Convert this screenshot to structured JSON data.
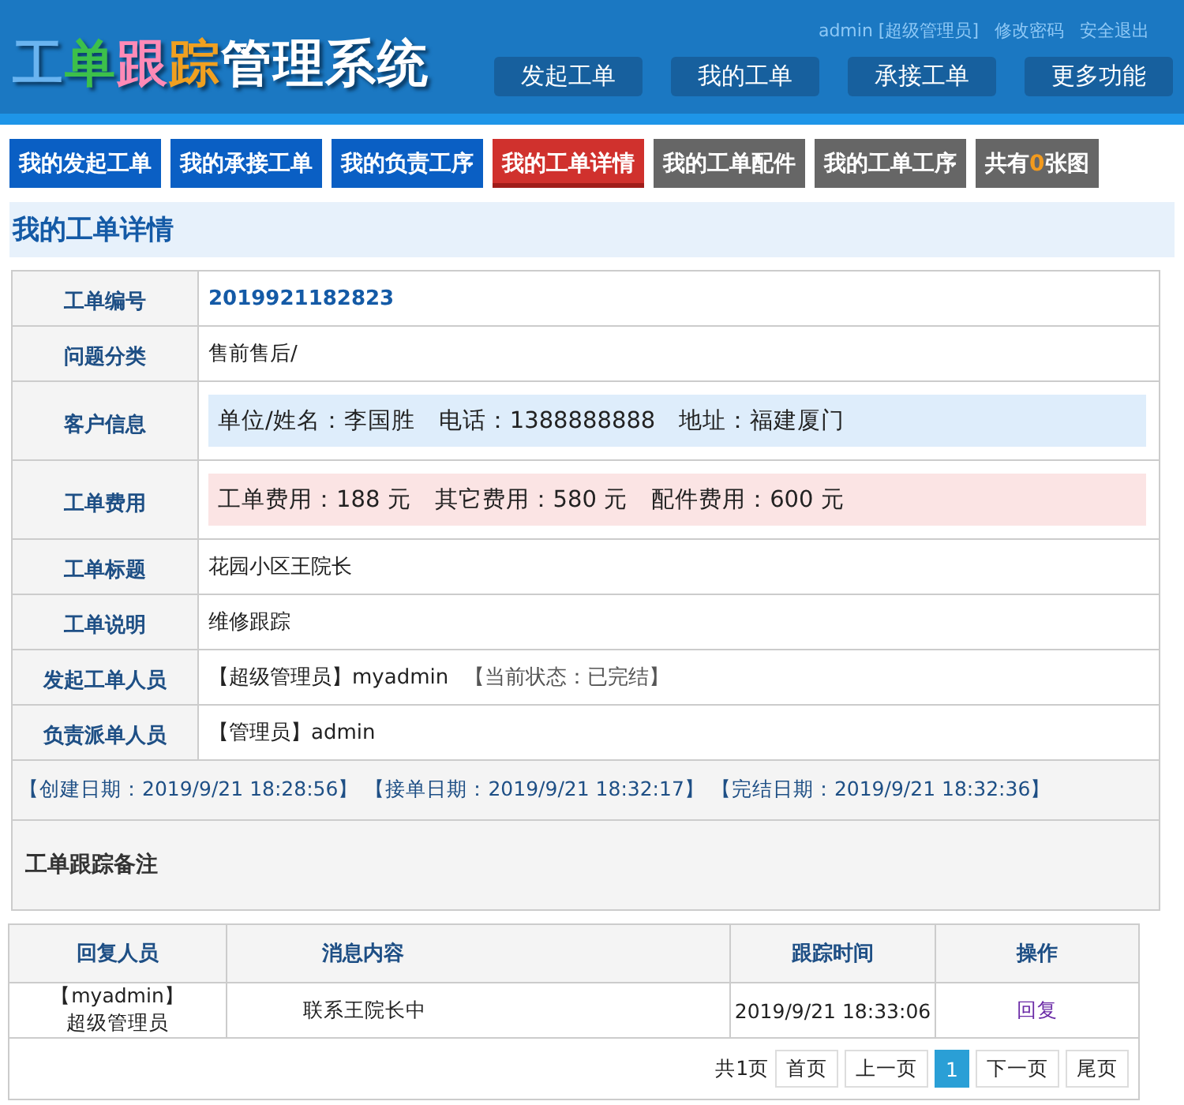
{
  "header": {
    "logo": [
      {
        "text": "工",
        "color": "#6ab4f0"
      },
      {
        "text": "单",
        "color": "#3cc04a"
      },
      {
        "text": "跟",
        "color": "#ff8ab6"
      },
      {
        "text": "踪",
        "color": "#f0a020"
      },
      {
        "text": "管理系统",
        "color": "#ffffff"
      }
    ],
    "user_links": [
      "admin [超级管理员]",
      "修改密码",
      "安全退出"
    ],
    "nav": [
      "发起工单",
      "我的工单",
      "承接工单",
      "更多功能"
    ]
  },
  "tabs": [
    {
      "label": "我的发起工单",
      "color": "#0a5fc4",
      "selected": false
    },
    {
      "label": "我的承接工单",
      "color": "#0a5fc4",
      "selected": false
    },
    {
      "label": "我的负责工序",
      "color": "#0a5fc4",
      "selected": false
    },
    {
      "label": "我的工单详情",
      "color": "#d0312d",
      "selected": true
    },
    {
      "label": "我的工单配件",
      "color": "#666666",
      "selected": false
    },
    {
      "label": "我的工单工序",
      "color": "#666666",
      "selected": false
    }
  ],
  "image_count": {
    "prefix": "共有",
    "count": "0",
    "suffix": "张图"
  },
  "section_title": "我的工单详情",
  "details": [
    {
      "label": "工单编号",
      "value": "2019921182823",
      "kind": "code"
    },
    {
      "label": "问题分类",
      "value": "售前售后/",
      "kind": "plain"
    },
    {
      "label": "客户信息",
      "value": "单位/姓名：李国胜　电话：1388888888　地址：福建厦门",
      "kind": "info"
    },
    {
      "label": "工单费用",
      "value": "工单费用：188 元　其它费用：580 元　配件费用：600 元",
      "kind": "alert"
    },
    {
      "label": "工单标题",
      "value": "花园小区王院长",
      "kind": "plain"
    },
    {
      "label": "工单说明",
      "value": "维修跟踪",
      "kind": "plain"
    },
    {
      "label": "发起工单人员",
      "value": "【超级管理员】myadmin",
      "status": "【当前状态：已完结】",
      "kind": "person"
    },
    {
      "label": "负责派单人员",
      "value": "【管理员】admin",
      "kind": "person"
    }
  ],
  "dates": [
    "【创建日期：2019/9/21 18:28:56】",
    "【接单日期：2019/9/21 18:32:17】",
    "【完结日期：2019/9/21 18:32:36】"
  ],
  "notes_title": "工单跟踪备注",
  "replies": {
    "columns": [
      "回复人员",
      "消息内容",
      "跟踪时间",
      "操作"
    ],
    "rows": [
      {
        "user": "【myadmin】",
        "role": "超级管理员",
        "message": "联系王院长中",
        "time": "2019/9/21 18:33:06",
        "action": "回复"
      }
    ]
  },
  "pagination": {
    "summary": "共1页",
    "buttons": [
      {
        "label": "首页",
        "selected": false
      },
      {
        "label": "上一页",
        "selected": false
      },
      {
        "label": "1",
        "selected": true
      },
      {
        "label": "下一页",
        "selected": false
      },
      {
        "label": "尾页",
        "selected": false
      }
    ]
  }
}
